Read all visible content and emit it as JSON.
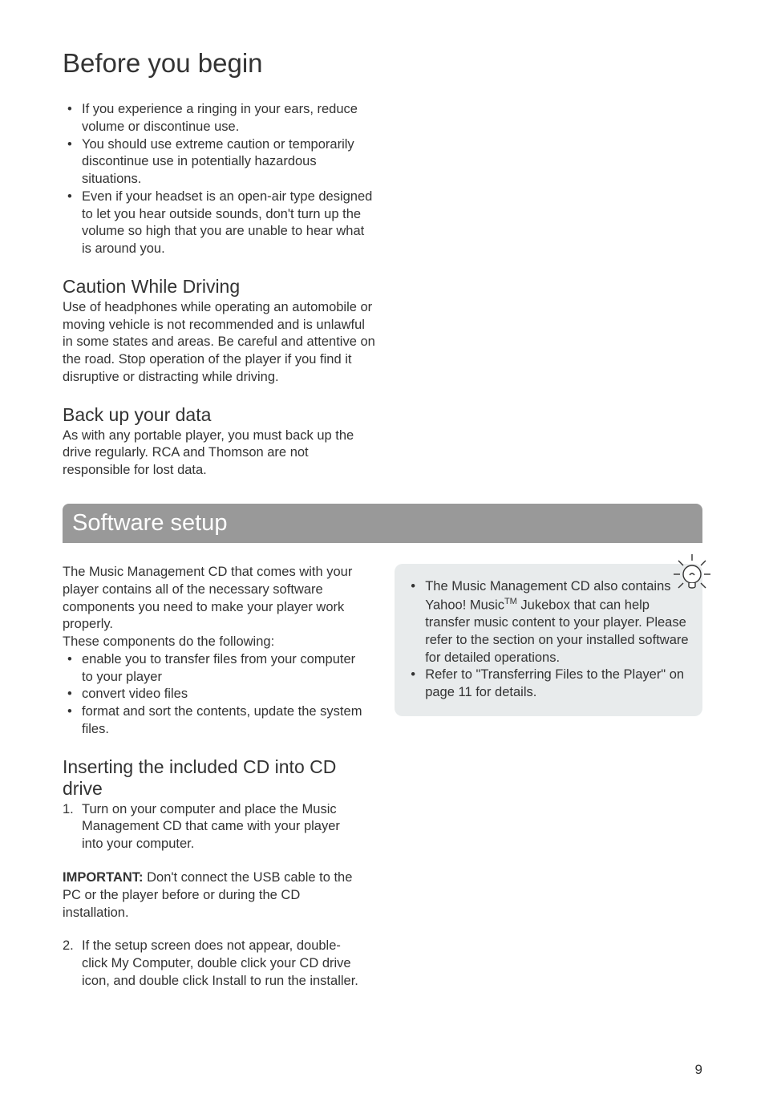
{
  "title": "Before you begin",
  "intro_bullets": [
    "If you experience a ringing in your ears, reduce volume or discontinue use.",
    "You should use extreme caution or temporarily discontinue use in potentially hazardous situations.",
    "Even if your headset is an open-air type designed to let you hear outside sounds, don't turn up the volume so high that you are unable to hear what is around you."
  ],
  "caution": {
    "heading": "Caution While Driving",
    "body": "Use of headphones while operating an automobile or moving vehicle is not recommended and is unlawful in some states and areas. Be careful and attentive on the road. Stop operation of the player if you find it disruptive or distracting while driving."
  },
  "backup": {
    "heading": "Back up your data",
    "body": "As with any portable player, you must back up the drive regularly. RCA and Thomson are not responsible for lost data."
  },
  "section2_title": "Software setup",
  "software_intro": "The Music Management CD that comes with your player contains all of the necessary software components you need to make your player work properly.",
  "components_line": "These components do the following:",
  "components": [
    "enable you to transfer files from your computer to your player",
    "convert video files",
    "format and sort the contents, update the system files."
  ],
  "inserting": {
    "heading": "Inserting the included CD into CD drive",
    "step1_num": "1.",
    "step1": "Turn on your computer and place the Music Management CD that came with your player into your computer.",
    "important_label": "IMPORTANT:",
    "important_body": " Don't connect the USB cable to the PC or the player before or during the CD installation.",
    "step2_num": "2.",
    "step2": "If the setup screen does not appear, double-click My Computer, double click your CD drive icon, and double click Install to run the installer."
  },
  "callout": {
    "line1a": "The Music Management CD also contains Yahoo! Music",
    "tm": "TM",
    "line1b": " Jukebox that can help transfer music content to your player. Please refer to the section on your installed software for detailed operations.",
    "line2": "Refer to \"Transferring Files to the Player\" on page 11 for details."
  },
  "page_number": "9"
}
